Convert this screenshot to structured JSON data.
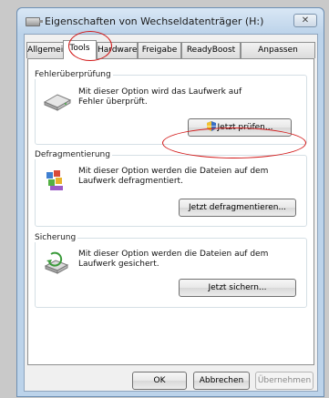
{
  "window": {
    "title": "Eigenschaften von Wechseldatenträger (H:)",
    "close_label": "✕"
  },
  "tabs": [
    {
      "label": "Allgemein",
      "active": false
    },
    {
      "label": "Tools",
      "active": true
    },
    {
      "label": "Hardware",
      "active": false
    },
    {
      "label": "Freigabe",
      "active": false
    },
    {
      "label": "ReadyBoost",
      "active": false
    },
    {
      "label": "Anpassen",
      "active": false
    }
  ],
  "groups": {
    "error_check": {
      "label": "Fehlerüberprüfung",
      "desc_line1": "Mit dieser Option wird das Laufwerk auf",
      "desc_line2": "Fehler überprüft.",
      "button": "Jetzt prüfen..."
    },
    "defrag": {
      "label": "Defragmentierung",
      "desc_line1": "Mit dieser Option werden die Dateien auf dem",
      "desc_line2": "Laufwerk defragmentiert.",
      "button": "Jetzt defragmentieren..."
    },
    "backup": {
      "label": "Sicherung",
      "desc_line1": "Mit dieser Option werden die Dateien auf dem",
      "desc_line2": "Laufwerk gesichert.",
      "button": "Jetzt sichern..."
    }
  },
  "footer": {
    "ok": "OK",
    "cancel": "Abbrechen",
    "apply": "Übernehmen"
  },
  "colors": {
    "annotation": "#d21818",
    "window_frame": "#bcd3ea"
  }
}
